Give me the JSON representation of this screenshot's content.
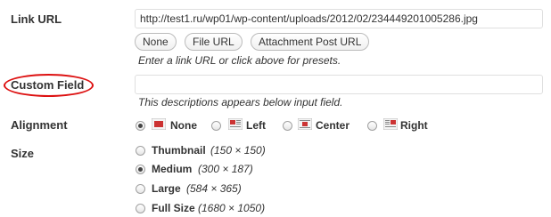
{
  "link_url": {
    "label": "Link URL",
    "value": "http://test1.ru/wp01/wp-content/uploads/2012/02/234449201005286.jpg",
    "buttons": [
      "None",
      "File URL",
      "Attachment Post URL"
    ],
    "help": "Enter a link URL or click above for presets."
  },
  "custom_field": {
    "label": "Custom Field",
    "value": "",
    "help": "This descriptions appears below input field."
  },
  "alignment": {
    "label": "Alignment",
    "options": [
      "None",
      "Left",
      "Center",
      "Right"
    ],
    "selected": "None"
  },
  "size": {
    "label": "Size",
    "options": [
      {
        "name": "Thumbnail",
        "dims": "(150 × 150)"
      },
      {
        "name": "Medium",
        "dims": "(300 × 187)"
      },
      {
        "name": "Large",
        "dims": "(584 × 365)"
      },
      {
        "name": "Full Size",
        "dims": "(1680 × 1050)"
      }
    ],
    "selected": "Medium"
  },
  "colors": {
    "highlight": "#dd1111",
    "icon_accent": "#cc3333"
  }
}
